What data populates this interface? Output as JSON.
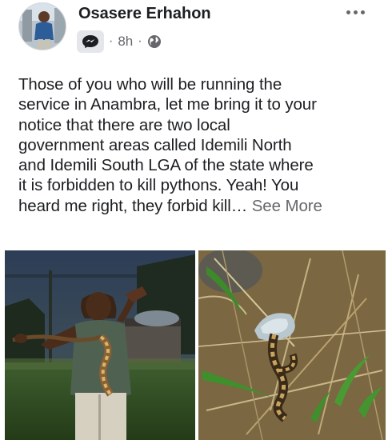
{
  "post": {
    "author": "Osasere Erhahon",
    "time": "8h",
    "privacy_icon": "globe-icon",
    "message_icon": "messenger-badge-icon",
    "more_icon": "more-horizontal-icon",
    "text_lines": [
      "Those of you who will be running the",
      "service in Anambra, let me bring it to your",
      "notice that there are two local",
      "government areas called Idemili North",
      "and Idemili South LGA of the state where",
      "it is forbidden to kill pythons. Yeah! You",
      "heard me right, they forbid kill…"
    ],
    "see_more_label": "See More"
  },
  "photos": [
    {
      "name": "man-holding-python-photo"
    },
    {
      "name": "python-in-grass-photo"
    }
  ],
  "colors": {
    "text": "#1c1e21",
    "secondary": "#65676b",
    "badge_bg": "#e4e6eb"
  }
}
